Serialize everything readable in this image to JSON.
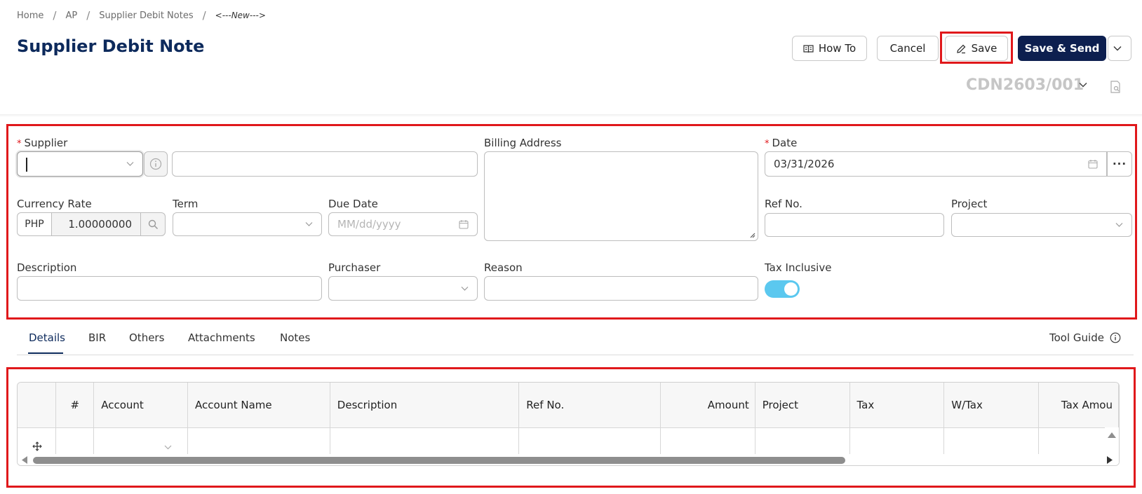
{
  "breadcrumb": {
    "items": [
      "Home",
      "AP",
      "Supplier Debit Notes"
    ],
    "current": "<---New--->"
  },
  "page": {
    "title": "Supplier Debit Note",
    "doc_number": "CDN2603/001"
  },
  "toolbar": {
    "howto_label": "How To",
    "cancel_label": "Cancel",
    "save_label": "Save",
    "save_send_label": "Save & Send"
  },
  "form": {
    "supplier": {
      "label": "Supplier",
      "value": "",
      "name_value": ""
    },
    "billing_address": {
      "label": "Billing Address",
      "value": ""
    },
    "date": {
      "label": "Date",
      "value": "03/31/2026"
    },
    "currency_rate": {
      "label": "Currency Rate",
      "currency": "PHP",
      "rate": "1.00000000"
    },
    "term": {
      "label": "Term",
      "value": ""
    },
    "due_date": {
      "label": "Due Date",
      "placeholder": "MM/dd/yyyy"
    },
    "ref_no": {
      "label": "Ref No.",
      "value": ""
    },
    "project": {
      "label": "Project",
      "value": ""
    },
    "description": {
      "label": "Description",
      "value": ""
    },
    "purchaser": {
      "label": "Purchaser",
      "value": ""
    },
    "reason": {
      "label": "Reason",
      "value": ""
    },
    "tax_inclusive": {
      "label": "Tax Inclusive",
      "on": true
    }
  },
  "tabs": [
    {
      "label": "Details",
      "active": true
    },
    {
      "label": "BIR",
      "active": false
    },
    {
      "label": "Others",
      "active": false
    },
    {
      "label": "Attachments",
      "active": false
    },
    {
      "label": "Notes",
      "active": false
    }
  ],
  "tool_guide": {
    "label": "Tool Guide"
  },
  "grid": {
    "columns": [
      "",
      "#",
      "Account",
      "Account Name",
      "Description",
      "Ref No.",
      "Amount",
      "Project",
      "Tax",
      "W/Tax",
      "Tax Amou"
    ]
  },
  "colors": {
    "primary": "#0d1f4f",
    "title": "#0d2a5c",
    "highlight": "#e0181b",
    "toggle": "#5bc8ef"
  }
}
